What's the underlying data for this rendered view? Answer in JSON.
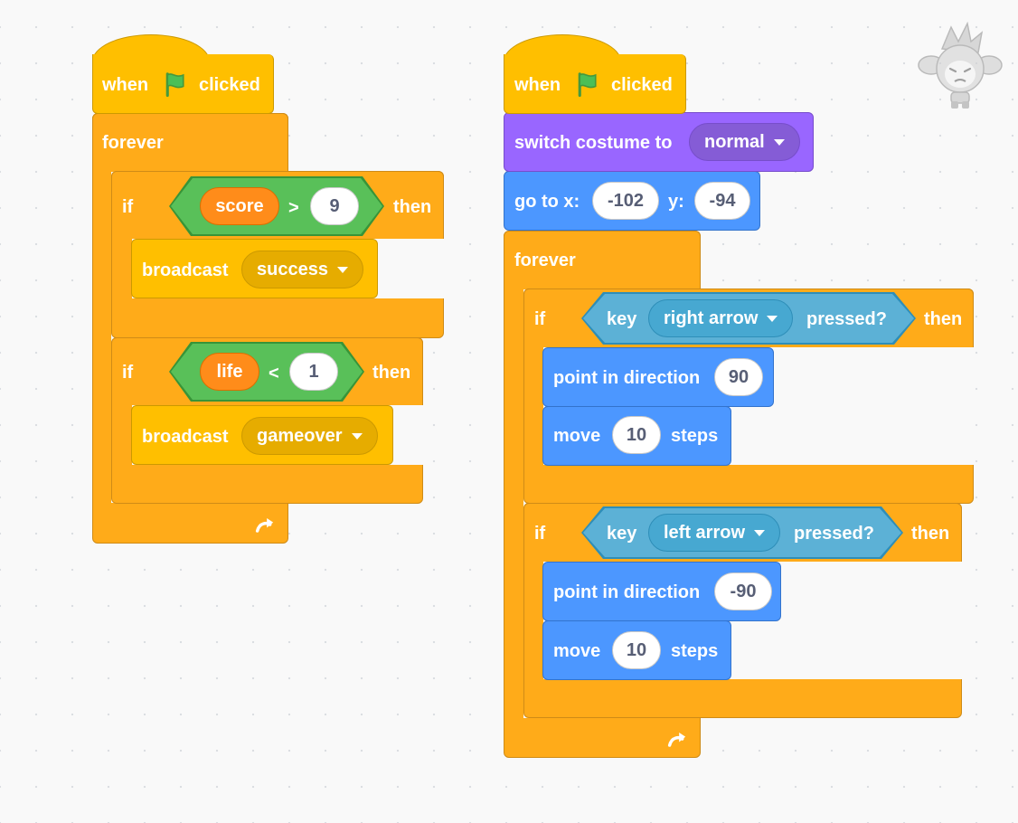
{
  "colors": {
    "events": "#ffbf00",
    "control": "#ffab19",
    "looks": "#9966ff",
    "motion": "#4c97ff",
    "sensing": "#5cb1d6",
    "operators": "#59c059",
    "variables": "#ff8c1a"
  },
  "script1": {
    "hat": {
      "when": "when",
      "clicked": "clicked",
      "icon": "green-flag-icon"
    },
    "forever": "forever",
    "if1": {
      "if": "if",
      "then": "then",
      "var": "score",
      "op": ">",
      "value": "9",
      "broadcast": "broadcast",
      "message": "success"
    },
    "if2": {
      "if": "if",
      "then": "then",
      "var": "life",
      "op": "<",
      "value": "1",
      "broadcast": "broadcast",
      "message": "gameover"
    }
  },
  "script2": {
    "hat": {
      "when": "when",
      "clicked": "clicked",
      "icon": "green-flag-icon"
    },
    "costume": {
      "label": "switch costume to",
      "value": "normal"
    },
    "goto": {
      "label": "go to x:",
      "x": "-102",
      "ylabel": "y:",
      "y": "-94"
    },
    "forever": "forever",
    "if1": {
      "if": "if",
      "then": "then",
      "key": "key",
      "key_value": "right arrow",
      "pressed": "pressed?",
      "point": "point in direction",
      "direction": "90",
      "move": "move",
      "steps_value": "10",
      "steps": "steps"
    },
    "if2": {
      "if": "if",
      "then": "then",
      "key": "key",
      "key_value": "left arrow",
      "pressed": "pressed?",
      "point": "point in direction",
      "direction": "-90",
      "move": "move",
      "steps_value": "10",
      "steps": "steps"
    }
  },
  "sprite": {
    "icon": "sprite-character-icon"
  }
}
